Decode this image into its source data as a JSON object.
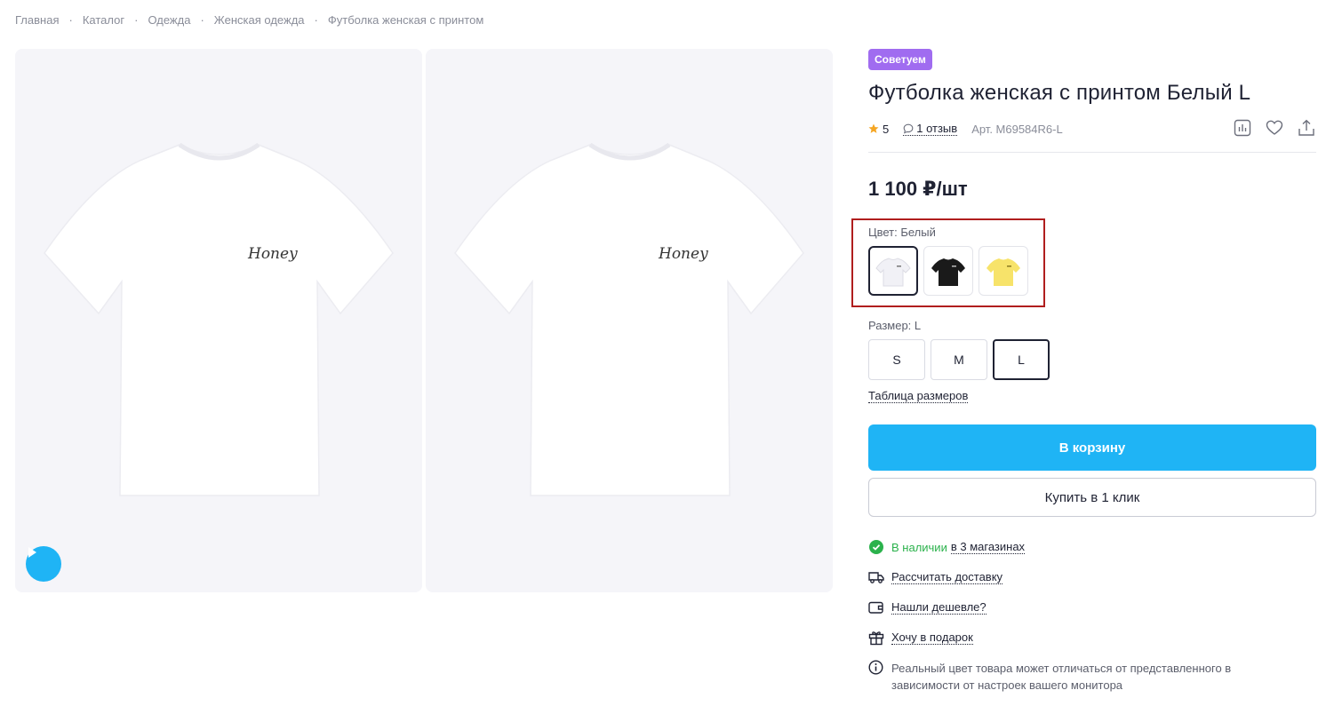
{
  "breadcrumb": {
    "items": [
      "Главная",
      "Каталог",
      "Одежда",
      "Женская одежда",
      "Футболка женская с принтом"
    ],
    "separator": "·"
  },
  "gallery": {
    "photos": [
      {
        "print_text": "Honey",
        "shirt_color": "#ffffff"
      },
      {
        "print_text": "Honey",
        "shirt_color": "#ffffff"
      }
    ],
    "play_icon": "play-icon"
  },
  "product": {
    "badge": "Советуем",
    "title": "Футболка женская с принтом Белый L",
    "rating": "5",
    "reviews": "1 отзыв",
    "sku": "Арт. M69584R6-L",
    "price": "1 100 ₽/шт"
  },
  "actions": [
    "compare-icon",
    "heart-icon",
    "share-icon"
  ],
  "color": {
    "label": "Цвет: Белый",
    "options": [
      {
        "name": "Белый",
        "hex": "#f4f4f8",
        "selected": true
      },
      {
        "name": "Черный",
        "hex": "#1a1a1a",
        "selected": false
      },
      {
        "name": "Желтый",
        "hex": "#f7e36a",
        "selected": false
      }
    ]
  },
  "size": {
    "label": "Размер: L",
    "options": [
      "S",
      "M",
      "L"
    ],
    "selected": "L",
    "table_link": "Таблица размеров"
  },
  "buttons": {
    "cart": "В корзину",
    "one_click": "Купить в 1 клик"
  },
  "perks": {
    "stock_prefix": "В наличии",
    "stock_link": "в 3 магазинах",
    "delivery": "Рассчитать доставку",
    "cheaper": "Нашли дешевле?",
    "gift": "Хочу в подарок",
    "note": "Реальный цвет товара может отличаться от представленного в зависимости от настроек вашего монитора"
  },
  "colors": {
    "accent": "#1fb4f5",
    "badge": "#a06cf0",
    "star": "#f5a623",
    "in_stock": "#2bb24c",
    "highlight_frame": "#b01e1e"
  }
}
